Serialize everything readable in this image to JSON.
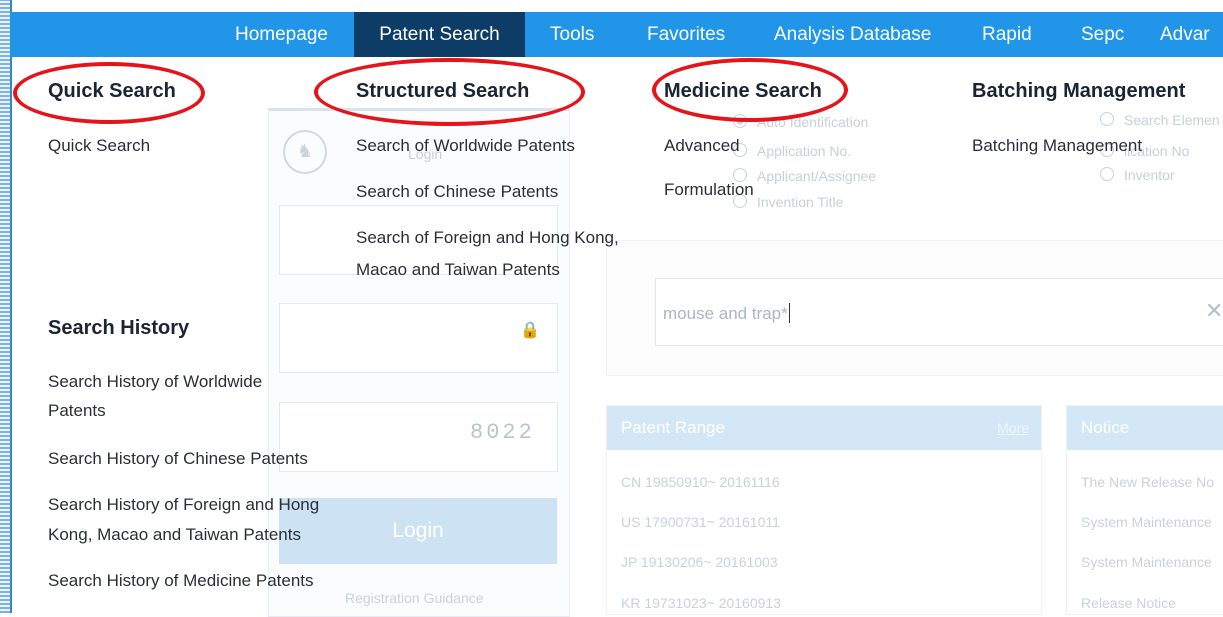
{
  "nav": {
    "items": [
      "Homepage",
      "Patent Search",
      "Tools",
      "Favorites",
      "Analysis Database",
      "Rapid",
      "Sepc",
      "Advar"
    ],
    "active": "Patent Search"
  },
  "menu": {
    "quick": {
      "heading": "Quick Search",
      "items": [
        "Quick Search"
      ]
    },
    "structured": {
      "heading": "Structured Search",
      "items": [
        "Search of Worldwide Patents",
        "Search of Chinese Patents",
        "Search of Foreign and Hong Kong,",
        "Macao and Taiwan Patents"
      ]
    },
    "medicine": {
      "heading": "Medicine Search",
      "items": [
        "Advanced",
        "Formulation"
      ]
    },
    "batching": {
      "heading": "Batching Management",
      "items": [
        "Batching Management"
      ]
    },
    "history": {
      "heading": "Search History",
      "items": [
        "Search History of Worldwide",
        "Patents",
        "Search History of Chinese Patents",
        "Search History of Foreign and Hong",
        "Kong, Macao and Taiwan Patents",
        "Search History of Medicine Patents"
      ]
    }
  },
  "login": {
    "hint": "Login",
    "captcha": "8022",
    "button": "Login",
    "registration": "Registration Guidance"
  },
  "search": {
    "options_left": [
      "Auto Identification",
      "Application No.",
      "Applicant/Assignee",
      "Invention Title"
    ],
    "options_right": [
      "Search Elemen",
      "lication No",
      "Inventor"
    ],
    "query": "mouse and trap*"
  },
  "patent_range": {
    "title": "Patent Range",
    "more": "More",
    "rows": [
      "CN 19850910~ 20161116",
      "US 17900731~ 20161011",
      "JP 19130206~ 20161003",
      "KR 19731023~ 20160913"
    ]
  },
  "notice": {
    "title": "Notice",
    "rows": [
      "The New Release No",
      "System Maintenance",
      "System Maintenance",
      "Release Notice"
    ]
  },
  "colors": {
    "nav_bg": "#2196e8",
    "nav_active": "#0d3d66",
    "highlight": "#e5141b"
  }
}
